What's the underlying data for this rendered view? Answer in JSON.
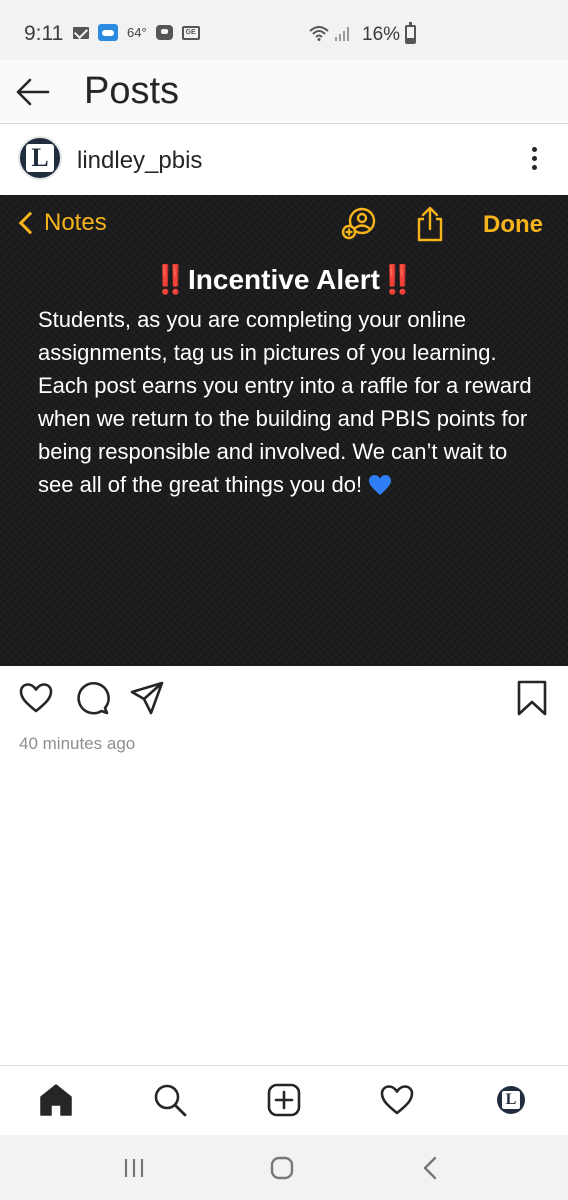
{
  "status_bar": {
    "time": "9:11",
    "temperature": "64°",
    "battery_percent": "16%",
    "icons": [
      "mail-icon",
      "weather-cloud-icon",
      "chat-icon",
      "ge-icon",
      "wifi-icon",
      "signal-icon",
      "battery-icon"
    ]
  },
  "header": {
    "title": "Posts",
    "back_icon": "arrow-left-icon"
  },
  "post": {
    "username": "lindley_pbis",
    "avatar_letter": "L",
    "more_icon": "more-vertical-icon",
    "image": {
      "notes_back_label": "Notes",
      "notes_done_label": "Done",
      "alert_title": "Incentive Alert",
      "alert_marks": "‼️",
      "body": "Students, as you are completing your online assignments, tag us in pictures of you learning. Each post earns you entry into a raffle for a reward when we return to the building and PBIS points for being responsible and involved. We can’t wait to see all of the great things you do!",
      "accent_color": "#f5b31c",
      "emoji": "blue-heart"
    },
    "timestamp": "40 minutes ago",
    "actions": [
      "like-icon",
      "comment-icon",
      "share-icon",
      "bookmark-icon"
    ]
  },
  "bottom_nav": {
    "items": [
      "home-icon",
      "search-icon",
      "add-post-icon",
      "activity-heart-icon",
      "profile-avatar"
    ],
    "profile_letter": "L"
  },
  "android_nav": [
    "recents-icon",
    "home-circle-icon",
    "back-chevron-icon"
  ]
}
